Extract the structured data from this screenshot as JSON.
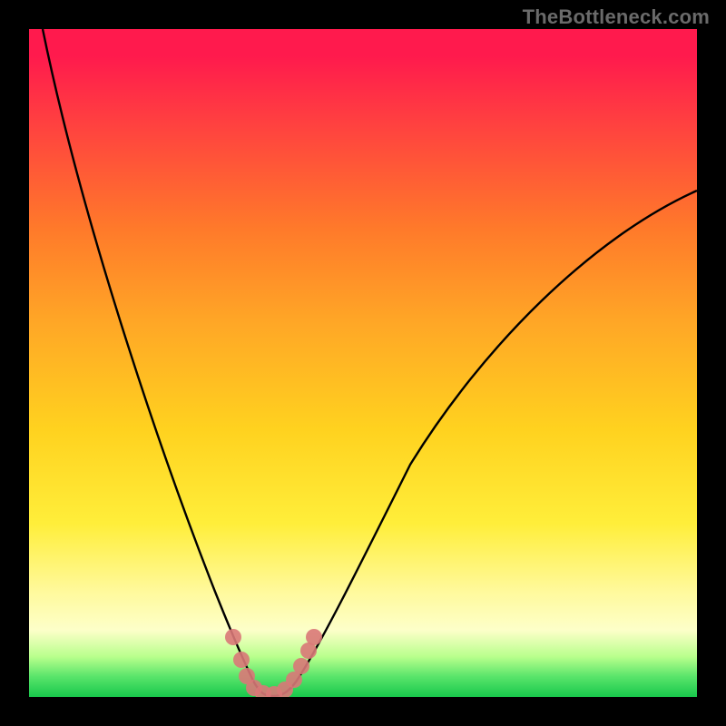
{
  "watermark": "TheBottleneck.com",
  "chart_data": {
    "type": "line",
    "title": "",
    "xlabel": "",
    "ylabel": "",
    "xlim": [
      0,
      100
    ],
    "ylim": [
      0,
      100
    ],
    "background": "radial-gradient red-to-green (top to bottom)",
    "series": [
      {
        "name": "bottleneck-curve",
        "color": "#000000",
        "x": [
          2,
          5,
          10,
          15,
          20,
          24,
          27,
          29,
          30,
          32,
          34,
          35,
          36,
          38,
          40,
          44,
          50,
          60,
          70,
          80,
          90,
          99
        ],
        "y": [
          100,
          88,
          70,
          55,
          40,
          28,
          18,
          10,
          6,
          1,
          0,
          0,
          1,
          3,
          8,
          17,
          30,
          48,
          61,
          68,
          73,
          76
        ]
      },
      {
        "name": "highlight-points",
        "color": "#d97878",
        "type": "scatter",
        "x": [
          28,
          30,
          31,
          33,
          35,
          37,
          38,
          39,
          40
        ],
        "y": [
          14,
          6,
          2,
          0,
          0,
          1,
          4,
          8,
          12
        ]
      }
    ],
    "annotations": []
  },
  "colors": {
    "top": "#ff1a4d",
    "mid": "#ffd21f",
    "bottom": "#18c84c",
    "curve": "#000000",
    "dots": "#d97878",
    "watermark": "#6a6a6a"
  }
}
